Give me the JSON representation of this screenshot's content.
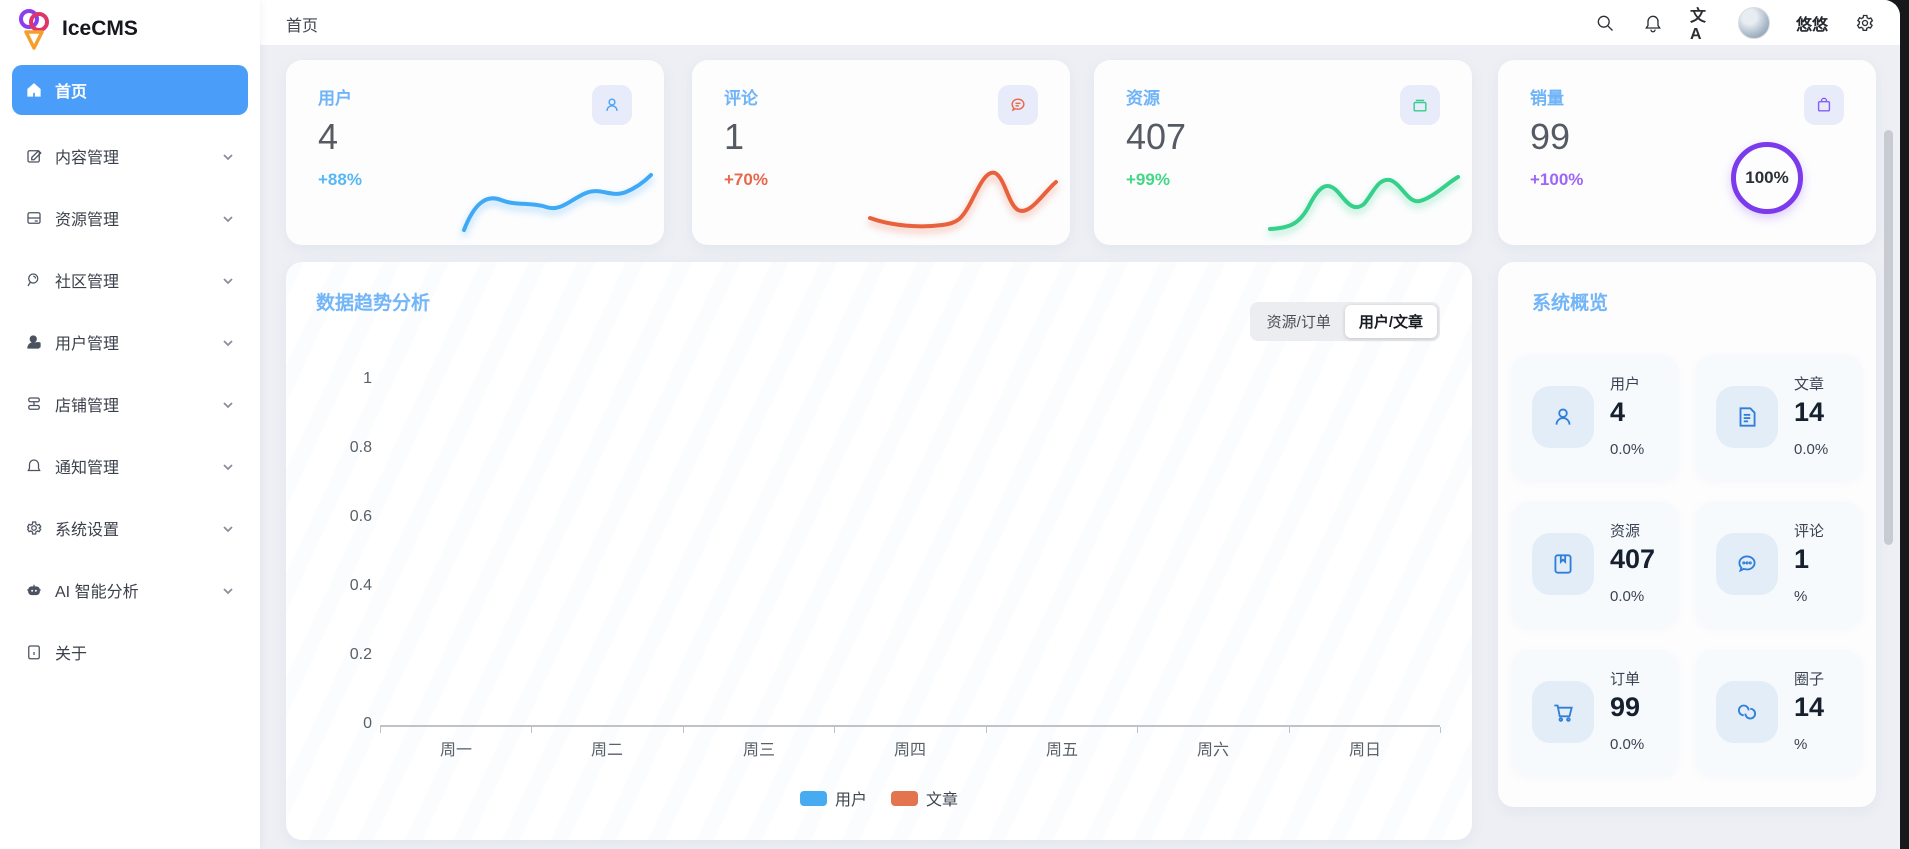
{
  "brand": {
    "name": "IceCMS",
    "logo_icon": "ice-cream-logo-icon"
  },
  "header": {
    "breadcrumb": "首页",
    "search_icon": "search-icon",
    "bell_icon": "bell-icon",
    "translate_icon": "translate-icon",
    "translate_glyph": "文A",
    "username": "悠悠",
    "settings_icon": "gear-icon"
  },
  "sidebar": {
    "items": [
      {
        "label": "首页",
        "icon": "home-icon",
        "active": true,
        "expandable": false
      },
      {
        "label": "内容管理",
        "icon": "edit-icon",
        "active": false,
        "expandable": true
      },
      {
        "label": "资源管理",
        "icon": "panel-icon",
        "active": false,
        "expandable": true
      },
      {
        "label": "社区管理",
        "icon": "magnifier-icon",
        "active": false,
        "expandable": true
      },
      {
        "label": "用户管理",
        "icon": "user-icon",
        "active": false,
        "expandable": true
      },
      {
        "label": "店铺管理",
        "icon": "shop-icon",
        "active": false,
        "expandable": true
      },
      {
        "label": "通知管理",
        "icon": "bell-icon",
        "active": false,
        "expandable": true
      },
      {
        "label": "系统设置",
        "icon": "gear-icon",
        "active": false,
        "expandable": true
      },
      {
        "label": "AI 智能分析",
        "icon": "robot-icon",
        "active": false,
        "expandable": true
      },
      {
        "label": "关于",
        "icon": "about-doc-icon",
        "active": false,
        "expandable": false
      }
    ]
  },
  "stat_cards": [
    {
      "title": "用户",
      "value": "4",
      "change": "+88%",
      "change_color": "#58b7f6",
      "icon": "user-icon",
      "icon_color": "#4aa3f5",
      "spark_color": "#3fa9f5"
    },
    {
      "title": "评论",
      "value": "1",
      "change": "+70%",
      "change_color": "#e8684b",
      "icon": "comment-icon",
      "icon_color": "#e8694b",
      "spark_color": "#e8613c"
    },
    {
      "title": "资源",
      "value": "407",
      "change": "+99%",
      "change_color": "#42d885",
      "icon": "box-icon",
      "icon_color": "#35ce8d",
      "spark_color": "#35d089"
    },
    {
      "title": "销量",
      "value": "99",
      "change": "+100%",
      "change_color": "#9d66f7",
      "icon": "shopping-bag-icon",
      "icon_color": "#8b5cf6",
      "ring_percent": "100%",
      "ring_color": "#7c3aed"
    }
  ],
  "chart_card": {
    "title": "数据趋势分析",
    "tabs": [
      {
        "label": "资源/订单",
        "active": false
      },
      {
        "label": "用户/文章",
        "active": true
      }
    ]
  },
  "chart_data": {
    "type": "line",
    "title": "数据趋势分析",
    "x": [
      "周一",
      "周二",
      "周三",
      "周四",
      "周五",
      "周六",
      "周日"
    ],
    "yticks": [
      "1",
      "0.8",
      "0.6",
      "0.4",
      "0.2",
      "0"
    ],
    "ylim": [
      0,
      1
    ],
    "grid": false,
    "legend_position": "bottom",
    "series": [
      {
        "name": "用户",
        "color": "#47abf1",
        "values": []
      },
      {
        "name": "文章",
        "color": "#e2754f",
        "values": []
      }
    ],
    "note": "axis rendered with no visible data lines (all series empty/zero)"
  },
  "overview": {
    "title": "系统概览",
    "tiles": [
      {
        "label": "用户",
        "value": "4",
        "percent": "0.0%",
        "icon": "user-icon"
      },
      {
        "label": "文章",
        "value": "14",
        "percent": "0.0%",
        "icon": "article-icon"
      },
      {
        "label": "资源",
        "value": "407",
        "percent": "0.0%",
        "icon": "book-icon"
      },
      {
        "label": "评论",
        "value": "1",
        "percent": "%",
        "icon": "comment-dots-icon"
      },
      {
        "label": "订单",
        "value": "99",
        "percent": "0.0%",
        "icon": "cart-icon"
      },
      {
        "label": "圈子",
        "value": "14",
        "percent": "%",
        "icon": "circle-link-icon"
      }
    ]
  },
  "colors": {
    "accent_blue": "#4a9df8",
    "title_blue": "#72b5f8",
    "page_bg": "#edeff4",
    "value_gray": "#565b63",
    "tile_value_navy": "#16202e"
  }
}
